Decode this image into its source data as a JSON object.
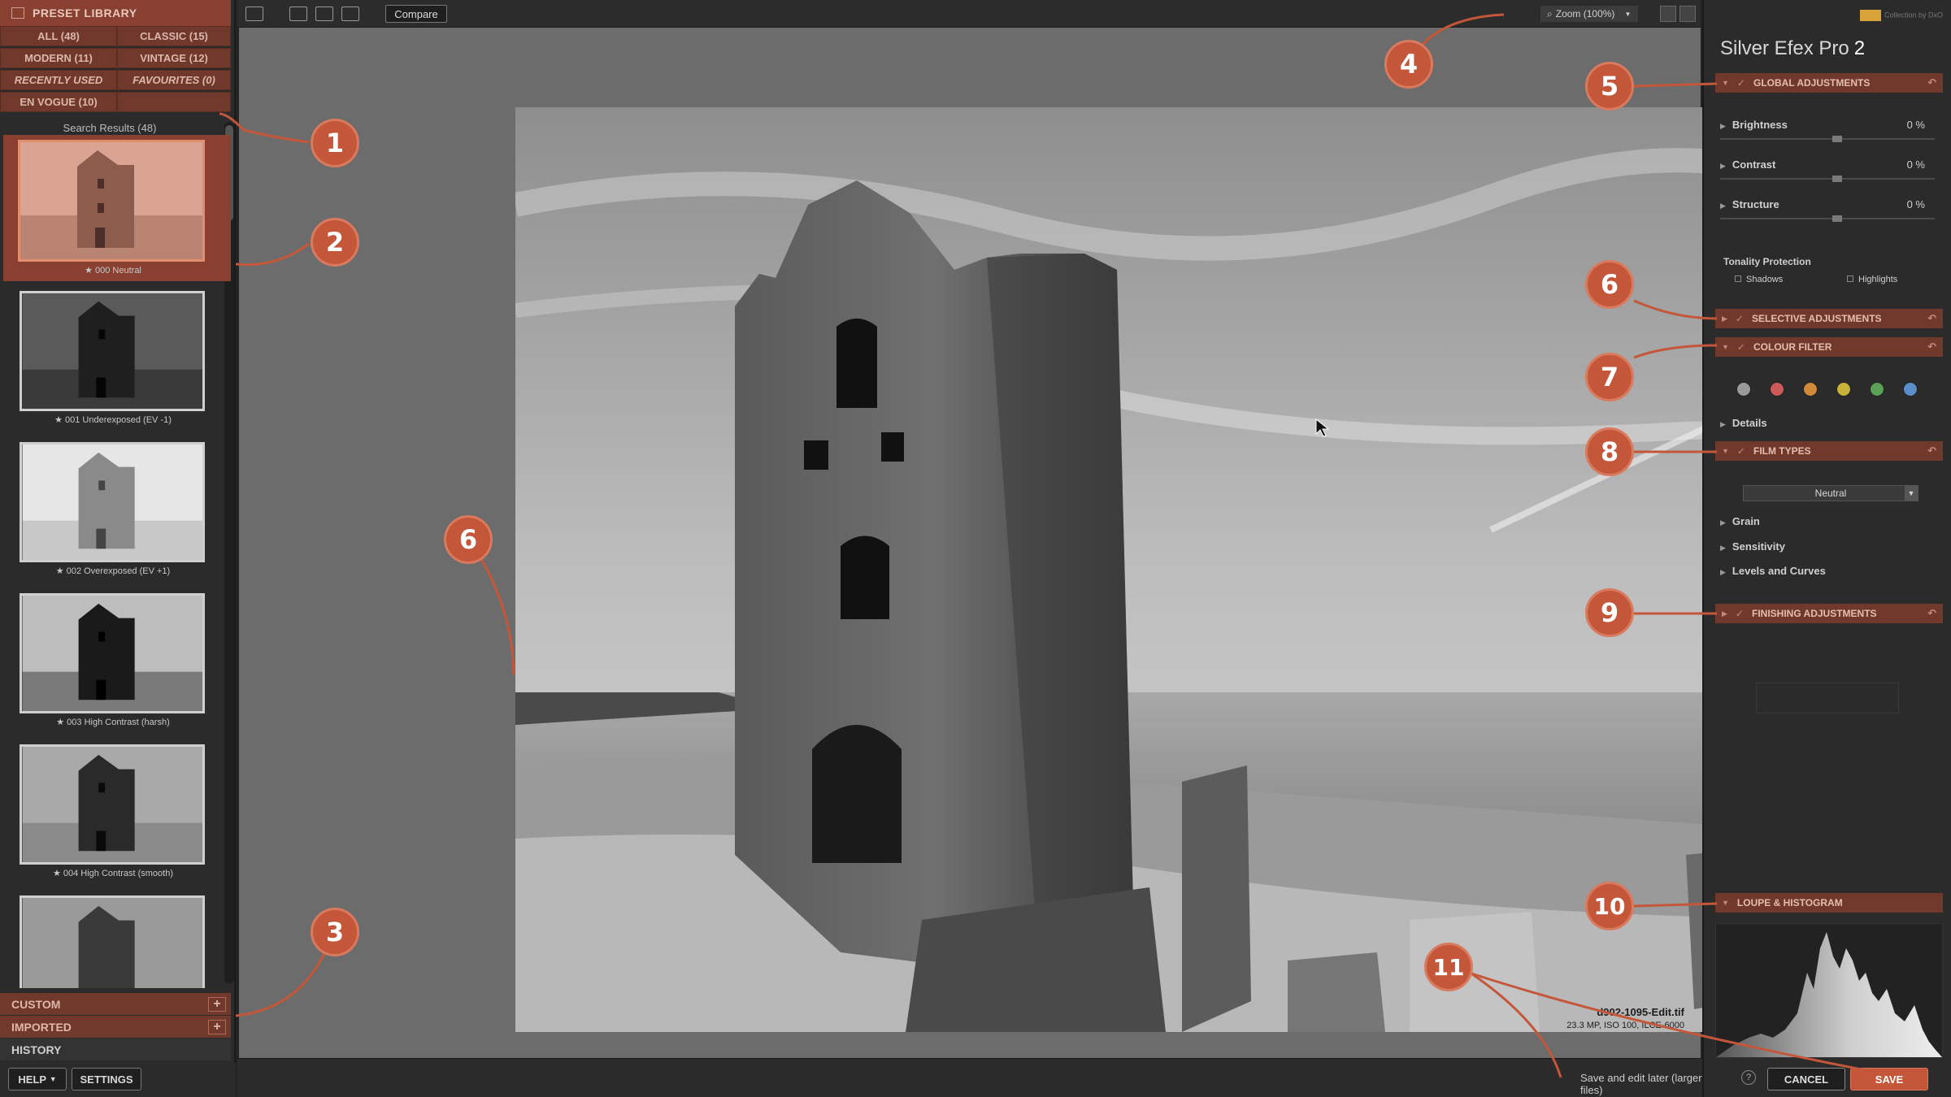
{
  "left": {
    "header": "PRESET LIBRARY",
    "categories": [
      {
        "label": "ALL (48)",
        "italic": false
      },
      {
        "label": "CLASSIC (15)",
        "italic": false
      },
      {
        "label": "MODERN (11)",
        "italic": false
      },
      {
        "label": "VINTAGE (12)",
        "italic": false
      },
      {
        "label": "RECENTLY USED",
        "italic": true
      },
      {
        "label": "FAVOURITES (0)",
        "italic": true
      },
      {
        "label": "EN VOGUE (10)",
        "italic": false
      }
    ],
    "search_results": "Search Results (48)",
    "presets": [
      {
        "label": "★ 000 Neutral",
        "tone": "sepia",
        "selected": true
      },
      {
        "label": "★ 001 Underexposed (EV -1)",
        "tone": "dark",
        "selected": false
      },
      {
        "label": "★ 002 Overexposed (EV +1)",
        "tone": "light",
        "selected": false
      },
      {
        "label": "★ 003 High Contrast (harsh)",
        "tone": "harsh",
        "selected": false
      },
      {
        "label": "★ 004 High Contrast (smooth)",
        "tone": "smooth",
        "selected": false
      },
      {
        "label": "",
        "tone": "mid",
        "selected": false
      }
    ],
    "custom": "CUSTOM",
    "imported": "IMPORTED",
    "history": "HISTORY",
    "help": "HELP",
    "settings": "SETTINGS"
  },
  "toolbar": {
    "compare": "Compare",
    "zoom": "Zoom (100%)"
  },
  "canvas": {
    "filename": "d902-1095-Edit.tif",
    "fileinfo": "23.3 MP, ISO 100, ILCE-6000"
  },
  "right": {
    "brand": "Silver Efex Pro",
    "brand_version": "2",
    "logo_text": "Collection by DxO",
    "global_adjustments": "GLOBAL ADJUSTMENTS",
    "brightness": {
      "label": "Brightness",
      "value": "0 %"
    },
    "contrast": {
      "label": "Contrast",
      "value": "0 %"
    },
    "structure": {
      "label": "Structure",
      "value": "0 %"
    },
    "tonality": "Tonality Protection",
    "shadows": "Shadows",
    "highlights": "Highlights",
    "selective_adjustments": "SELECTIVE ADJUSTMENTS",
    "colour_filter": "COLOUR FILTER",
    "filter_colors": [
      "#9a9a9a",
      "#cc5a5a",
      "#d08a3a",
      "#c9b23a",
      "#5aa055",
      "#5a8ec9"
    ],
    "details": "Details",
    "film_types": "FILM TYPES",
    "film_select": "Neutral",
    "grain": "Grain",
    "sensitivity": "Sensitivity",
    "levels": "Levels and Curves",
    "finishing_adjustments": "FINISHING ADJUSTMENTS",
    "loupe": "LOUPE & HISTOGRAM"
  },
  "bottom": {
    "save_edit": "Save and edit later (larger files)",
    "cancel": "CANCEL",
    "save": "SAVE",
    "help_icon": "?"
  },
  "callouts": [
    "1",
    "2",
    "3",
    "4",
    "5",
    "6",
    "6",
    "7",
    "8",
    "9",
    "10",
    "11"
  ],
  "colors": {
    "accent": "#c4573a",
    "panel_header": "#70392c",
    "panel_bg": "#2b2b2b"
  }
}
